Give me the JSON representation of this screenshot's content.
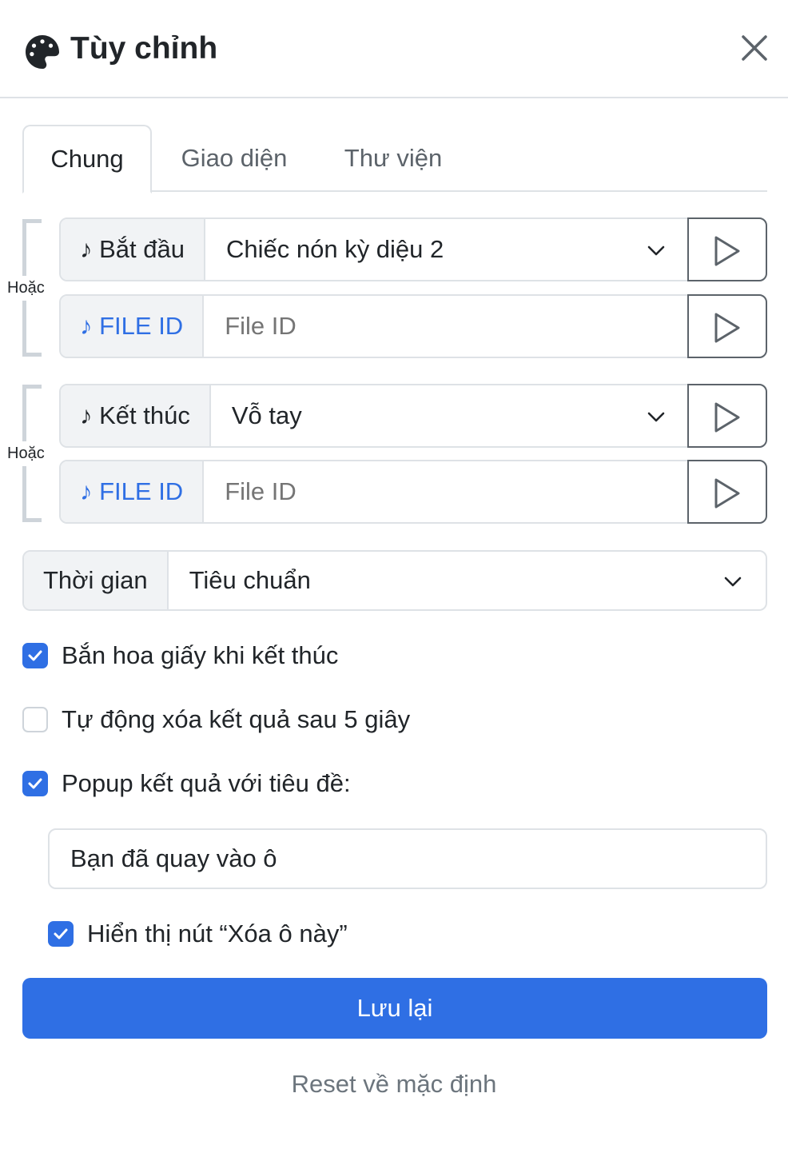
{
  "header": {
    "title": "Tùy chỉnh",
    "icon": "palette-icon",
    "close_icon": "close-icon"
  },
  "tabs": [
    {
      "label": "Chung",
      "active": true
    },
    {
      "label": "Giao diện",
      "active": false
    },
    {
      "label": "Thư viện",
      "active": false
    }
  ],
  "sound_groups": [
    {
      "or_label": "Hoặc",
      "select_prefix": "♪ Bắt đầu",
      "select_value": "Chiếc nón kỳ diệu 2",
      "file_prefix": "♪ FILE ID",
      "file_placeholder": "File ID"
    },
    {
      "or_label": "Hoặc",
      "select_prefix": "♪ Kết thúc",
      "select_value": "Vỗ tay",
      "file_prefix": "♪ FILE ID",
      "file_placeholder": "File ID"
    }
  ],
  "time": {
    "label": "Thời gian",
    "value": "Tiêu chuẩn"
  },
  "options": [
    {
      "label": "Bắn hoa giấy khi kết thúc",
      "checked": true
    },
    {
      "label": "Tự động xóa kết quả sau 5 giây",
      "checked": false
    },
    {
      "label": "Popup kết quả với tiêu đề:",
      "checked": true
    }
  ],
  "popup_title_value": "Bạn đã quay vào ô",
  "show_delete_button": {
    "label": "Hiển thị nút “Xóa ô này”",
    "checked": true
  },
  "save_label": "Lưu lại",
  "reset_label": "Reset về mặc định",
  "colors": {
    "primary": "#2f6fe4",
    "border": "#dee2e6",
    "muted_text": "#6c757d"
  }
}
